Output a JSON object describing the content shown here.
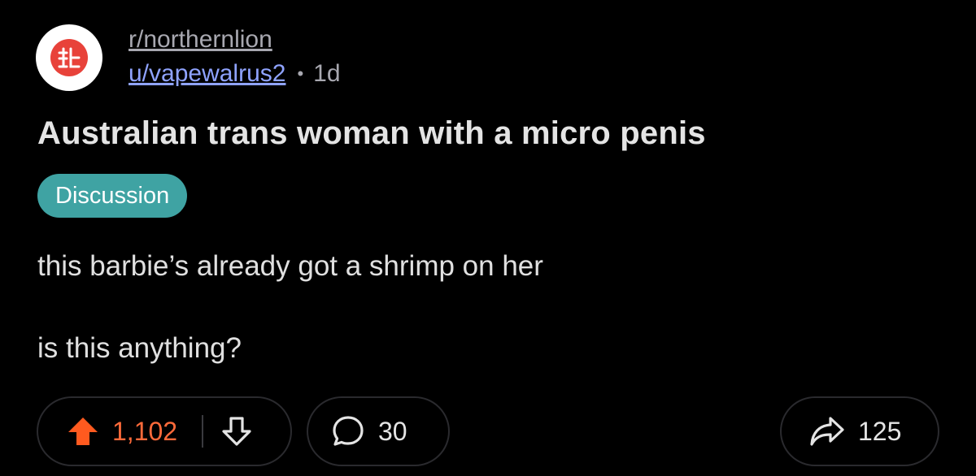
{
  "post": {
    "subreddit": "r/northernlion",
    "username": "u/vapewalrus2",
    "separator": "•",
    "age": "1d",
    "title": "Australian trans woman with a micro penis",
    "flair": "Discussion",
    "body": [
      "this barbie’s already got a shrimp on her",
      "is this anything?"
    ]
  },
  "actions": {
    "upvotes": "1,102",
    "comments": "30",
    "shares": "125"
  },
  "icons": {
    "avatar": "northernlion-logo-icon",
    "upvote": "upvote-arrow-icon",
    "downvote": "downvote-arrow-icon",
    "comment": "comment-bubble-icon",
    "share": "share-arrow-icon"
  },
  "colors": {
    "background": "#000000",
    "avatar_red": "#e8423a",
    "upvote_orange": "#ff5a1f",
    "score_orange": "#ff6a3a",
    "flair_teal": "#3fa3a3",
    "username_blue": "#8fa3ff",
    "muted_gray": "#a8a8b0"
  }
}
